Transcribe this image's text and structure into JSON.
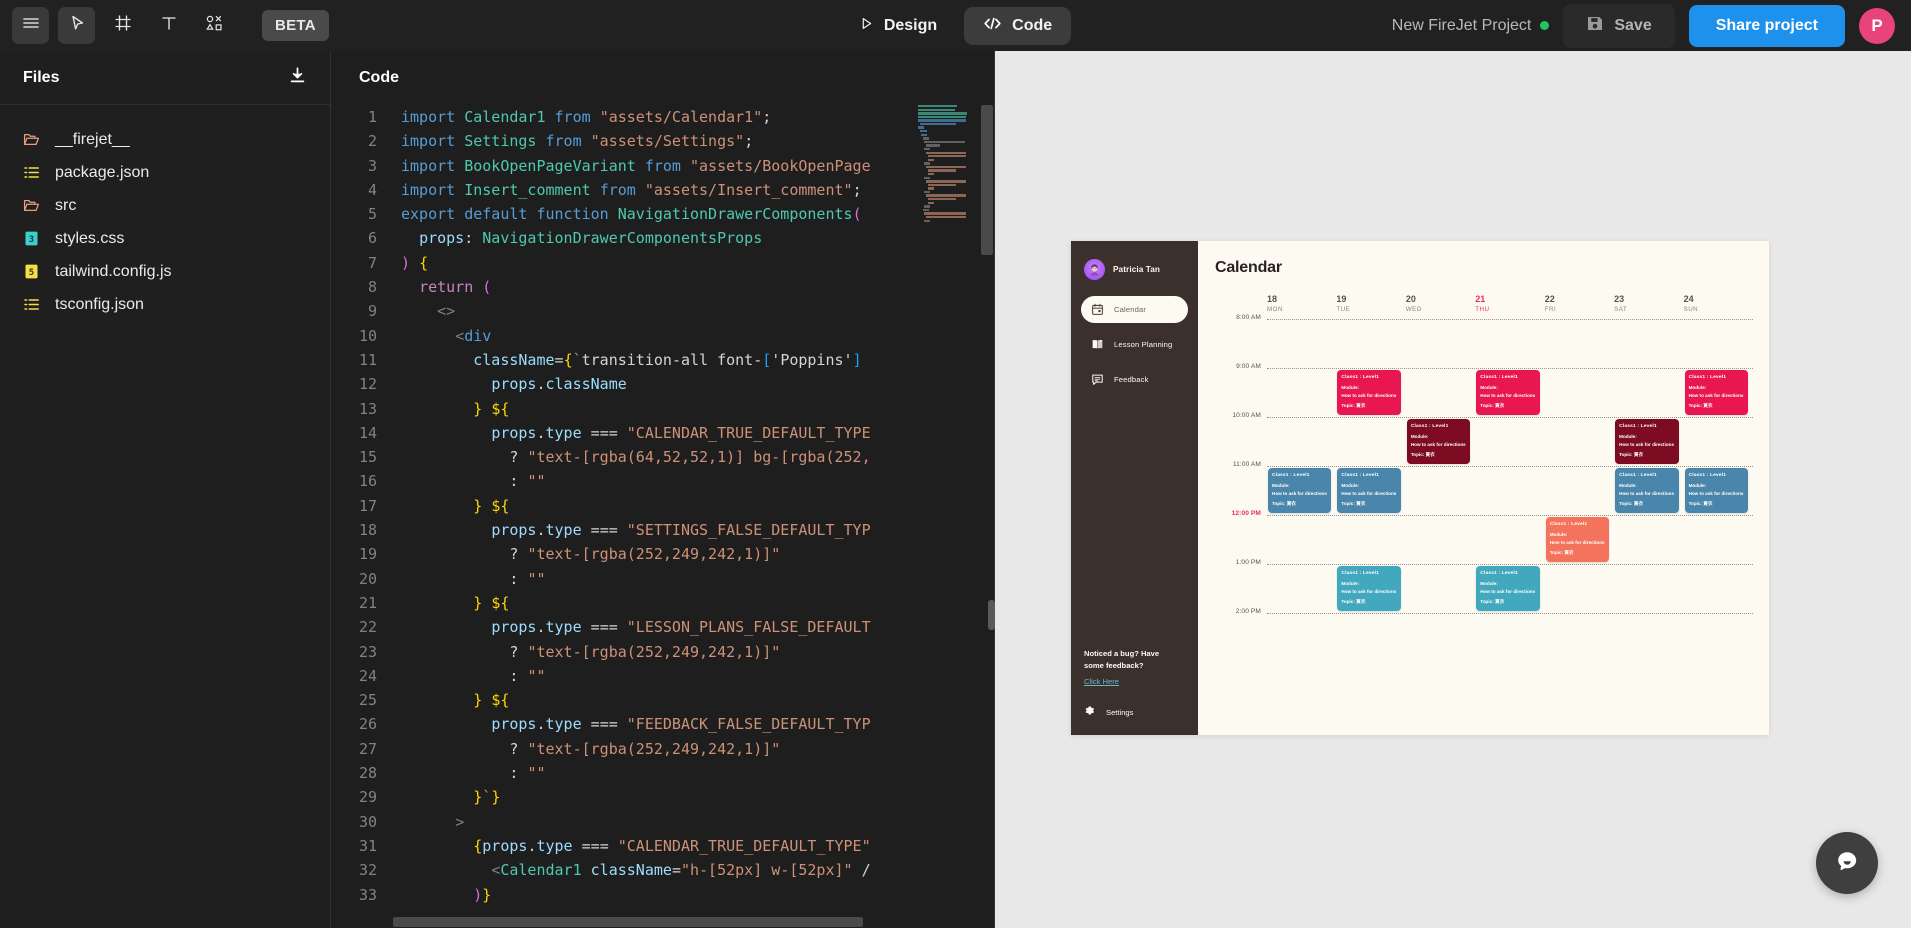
{
  "topbar": {
    "menu_icon": "hamburger-menu-icon",
    "cursor_icon": "cursor-select-icon",
    "frame_icon": "frame-icon",
    "text_icon": "text-tool-icon",
    "components_icon": "components-icon",
    "beta_label": "BETA",
    "design_label": "Design",
    "code_label": "Code",
    "project_name": "New FireJet Project",
    "status_dot_color": "#22c55e",
    "save_label": "Save",
    "share_label": "Share project",
    "avatar_initial": "P",
    "avatar_color": "#e8437d",
    "share_color": "#1d91eb"
  },
  "files": {
    "title": "Files",
    "download_icon": "download-icon",
    "items": [
      {
        "name": "__firejet__",
        "icon": "folder-icon",
        "color": "#e8a080"
      },
      {
        "name": "package.json",
        "icon": "json-icon",
        "color": "#f2e04a"
      },
      {
        "name": "src",
        "icon": "folder-icon",
        "color": "#e8a080"
      },
      {
        "name": "styles.css",
        "icon": "css-icon",
        "color": "#3bd0c8"
      },
      {
        "name": "tailwind.config.js",
        "icon": "js-icon",
        "color": "#f2e04a"
      },
      {
        "name": "tsconfig.json",
        "icon": "json-icon",
        "color": "#f2e04a"
      }
    ]
  },
  "code": {
    "title": "Code",
    "lines": [
      {
        "n": 1,
        "text": "import Calendar1 from \"assets/Calendar1\";"
      },
      {
        "n": 2,
        "text": "import Settings from \"assets/Settings\";"
      },
      {
        "n": 3,
        "text": "import BookOpenPageVariant from \"assets/BookOpenPage"
      },
      {
        "n": 4,
        "text": "import Insert_comment from \"assets/Insert_comment\";"
      },
      {
        "n": 5,
        "text": "export default function NavigationDrawerComponents("
      },
      {
        "n": 6,
        "text": "  props: NavigationDrawerComponentsProps"
      },
      {
        "n": 7,
        "text": ") {"
      },
      {
        "n": 8,
        "text": "  return ("
      },
      {
        "n": 9,
        "text": "    <>"
      },
      {
        "n": 10,
        "text": "      <div"
      },
      {
        "n": 11,
        "text": "        className={`transition-all font-['Poppins'] "
      },
      {
        "n": 12,
        "text": "          props.className"
      },
      {
        "n": 13,
        "text": "        } ${"
      },
      {
        "n": 14,
        "text": "          props.type === \"CALENDAR_TRUE_DEFAULT_TYPE"
      },
      {
        "n": 15,
        "text": "            ? \"text-[rgba(64,52,52,1)] bg-[rgba(252,"
      },
      {
        "n": 16,
        "text": "            : \"\""
      },
      {
        "n": 17,
        "text": "        } ${"
      },
      {
        "n": 18,
        "text": "          props.type === \"SETTINGS_FALSE_DEFAULT_TYP"
      },
      {
        "n": 19,
        "text": "            ? \"text-[rgba(252,249,242,1)]\""
      },
      {
        "n": 20,
        "text": "            : \"\""
      },
      {
        "n": 21,
        "text": "        } ${"
      },
      {
        "n": 22,
        "text": "          props.type === \"LESSON_PLANS_FALSE_DEFAULT"
      },
      {
        "n": 23,
        "text": "            ? \"text-[rgba(252,249,242,1)]\""
      },
      {
        "n": 24,
        "text": "            : \"\""
      },
      {
        "n": 25,
        "text": "        } ${"
      },
      {
        "n": 26,
        "text": "          props.type === \"FEEDBACK_FALSE_DEFAULT_TYP"
      },
      {
        "n": 27,
        "text": "            ? \"text-[rgba(252,249,242,1)]\""
      },
      {
        "n": 28,
        "text": "            : \"\""
      },
      {
        "n": 29,
        "text": "        }`}"
      },
      {
        "n": 30,
        "text": "      >"
      },
      {
        "n": 31,
        "text": "        {props.type === \"CALENDAR_TRUE_DEFAULT_TYPE\""
      },
      {
        "n": 32,
        "text": "          <Calendar1 className=\"h-[52px] w-[52px]\" /"
      },
      {
        "n": 33,
        "text": "        )}"
      }
    ]
  },
  "preview": {
    "drawer": {
      "user_name": "Patricia Tan",
      "nav": [
        {
          "label": "Calendar",
          "icon": "calendar-icon",
          "active": true
        },
        {
          "label": "Lesson Planning",
          "icon": "book-open-icon",
          "active": false
        },
        {
          "label": "Feedback",
          "icon": "comment-icon",
          "active": false
        }
      ],
      "bug_text_line1": "Noticed a bug? Have",
      "bug_text_line2": "some feedback?",
      "bug_link": "Click Here",
      "settings_label": "Settings",
      "settings_icon": "gear-icon",
      "bg_color": "#3b302c"
    },
    "calendar": {
      "title": "Calendar",
      "today_color": "#ed2a63",
      "days": [
        {
          "num": "18",
          "name": "MON",
          "today": false
        },
        {
          "num": "19",
          "name": "TUE",
          "today": false
        },
        {
          "num": "20",
          "name": "WED",
          "today": false
        },
        {
          "num": "21",
          "name": "THU",
          "today": true
        },
        {
          "num": "22",
          "name": "FRI",
          "today": false
        },
        {
          "num": "23",
          "name": "SAT",
          "today": false
        },
        {
          "num": "24",
          "name": "SUN",
          "today": false
        }
      ],
      "hours": [
        {
          "label": "8:00 AM",
          "now": false
        },
        {
          "label": "9:00 AM",
          "now": false
        },
        {
          "label": "10:00 AM",
          "now": false
        },
        {
          "label": "11:00 AM",
          "now": false
        },
        {
          "label": "12:00 PM",
          "now": true
        },
        {
          "label": "1:00 PM",
          "now": false
        },
        {
          "label": "2:00 PM",
          "now": false
        }
      ],
      "event_text": {
        "line1": "Class1 : Level1",
        "line2": "Module:",
        "line3": "How to ask for directions",
        "line4": "Topic: 買衣"
      },
      "events": [
        {
          "day": 1,
          "start": "9:00 AM",
          "end": "10:00 AM",
          "color": "#e8174f",
          "slot": 0
        },
        {
          "day": 3,
          "start": "9:00 AM",
          "end": "10:00 AM",
          "color": "#e8174f",
          "slot": 0
        },
        {
          "day": 6,
          "start": "9:00 AM",
          "end": "10:00 AM",
          "color": "#e8174f",
          "slot": 0
        },
        {
          "day": 2,
          "start": "10:00 AM",
          "end": "11:00 AM",
          "color": "#7d0b21",
          "slot": 0
        },
        {
          "day": 5,
          "start": "10:00 AM",
          "end": "11:00 AM",
          "color": "#7d0b21",
          "slot": 0
        },
        {
          "day": 0,
          "start": "11:00 AM",
          "end": "12:00 PM",
          "color": "#4a86ab",
          "slot": 0
        },
        {
          "day": 1,
          "start": "11:00 AM",
          "end": "12:00 PM",
          "color": "#4a86ab",
          "slot": 0
        },
        {
          "day": 5,
          "start": "11:00 AM",
          "end": "12:00 PM",
          "color": "#4a86ab",
          "slot": 0
        },
        {
          "day": 6,
          "start": "11:00 AM",
          "end": "12:00 PM",
          "color": "#4a86ab",
          "slot": 0
        },
        {
          "day": 4,
          "start": "12:00 PM",
          "end": "1:00 PM",
          "color": "#f4735c",
          "slot": 0
        },
        {
          "day": 1,
          "start": "1:00 PM",
          "end": "2:00 PM",
          "color": "#42a8bd",
          "slot": 0
        },
        {
          "day": 3,
          "start": "1:00 PM",
          "end": "2:00 PM",
          "color": "#42a8bd",
          "slot": 0
        }
      ],
      "bg_color": "#fdfaf2"
    }
  },
  "chat_widget": {
    "icon": "chat-bubble-icon"
  }
}
